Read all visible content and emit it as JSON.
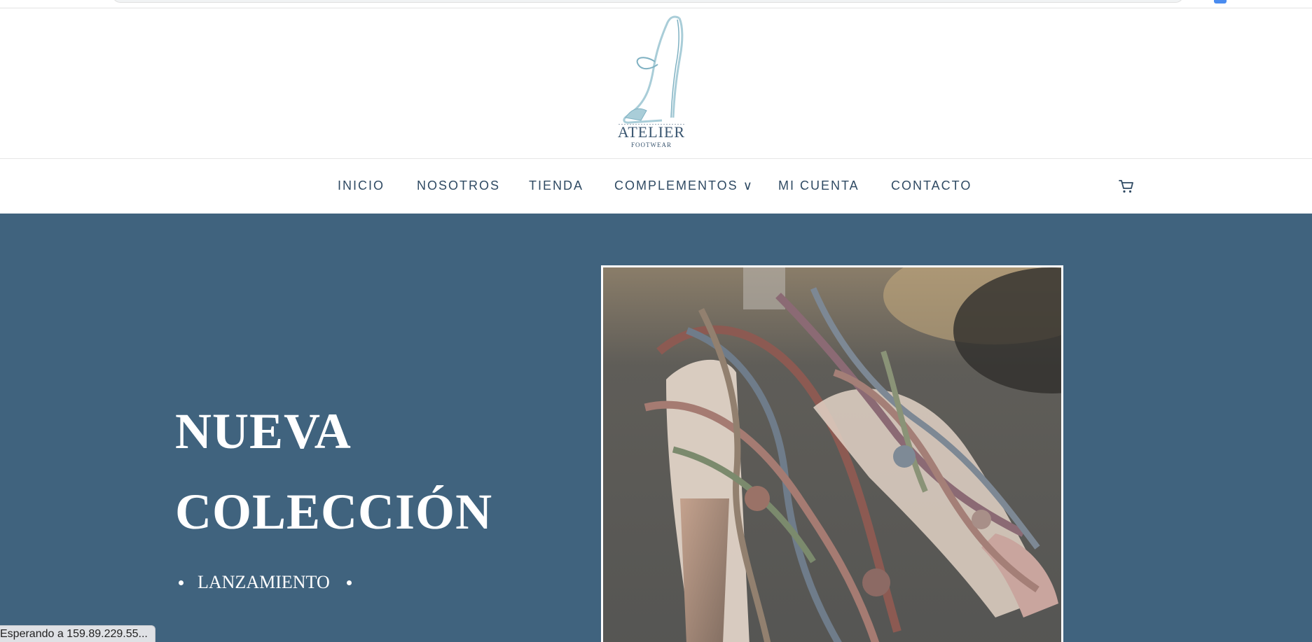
{
  "logo": {
    "word": "ATELIER",
    "sub": "FOOTWEAR"
  },
  "nav": {
    "items": [
      {
        "label": "INICIO"
      },
      {
        "label": "NOSOTROS"
      },
      {
        "label": "TIENDA"
      },
      {
        "label": "COMPLEMENTOS ∨"
      },
      {
        "label": "MI CUENTA"
      },
      {
        "label": "CONTACTO"
      }
    ],
    "cart_icon": "cart-icon"
  },
  "hero": {
    "title_line1": "NUEVA",
    "title_line2": "COLECCIÓN",
    "tag": "LANZAMIENTO",
    "background": "#40637e",
    "photo_alt_icon": "floral-sandals-photo"
  },
  "status": {
    "text": "Esperando a 159.89.229.55..."
  }
}
